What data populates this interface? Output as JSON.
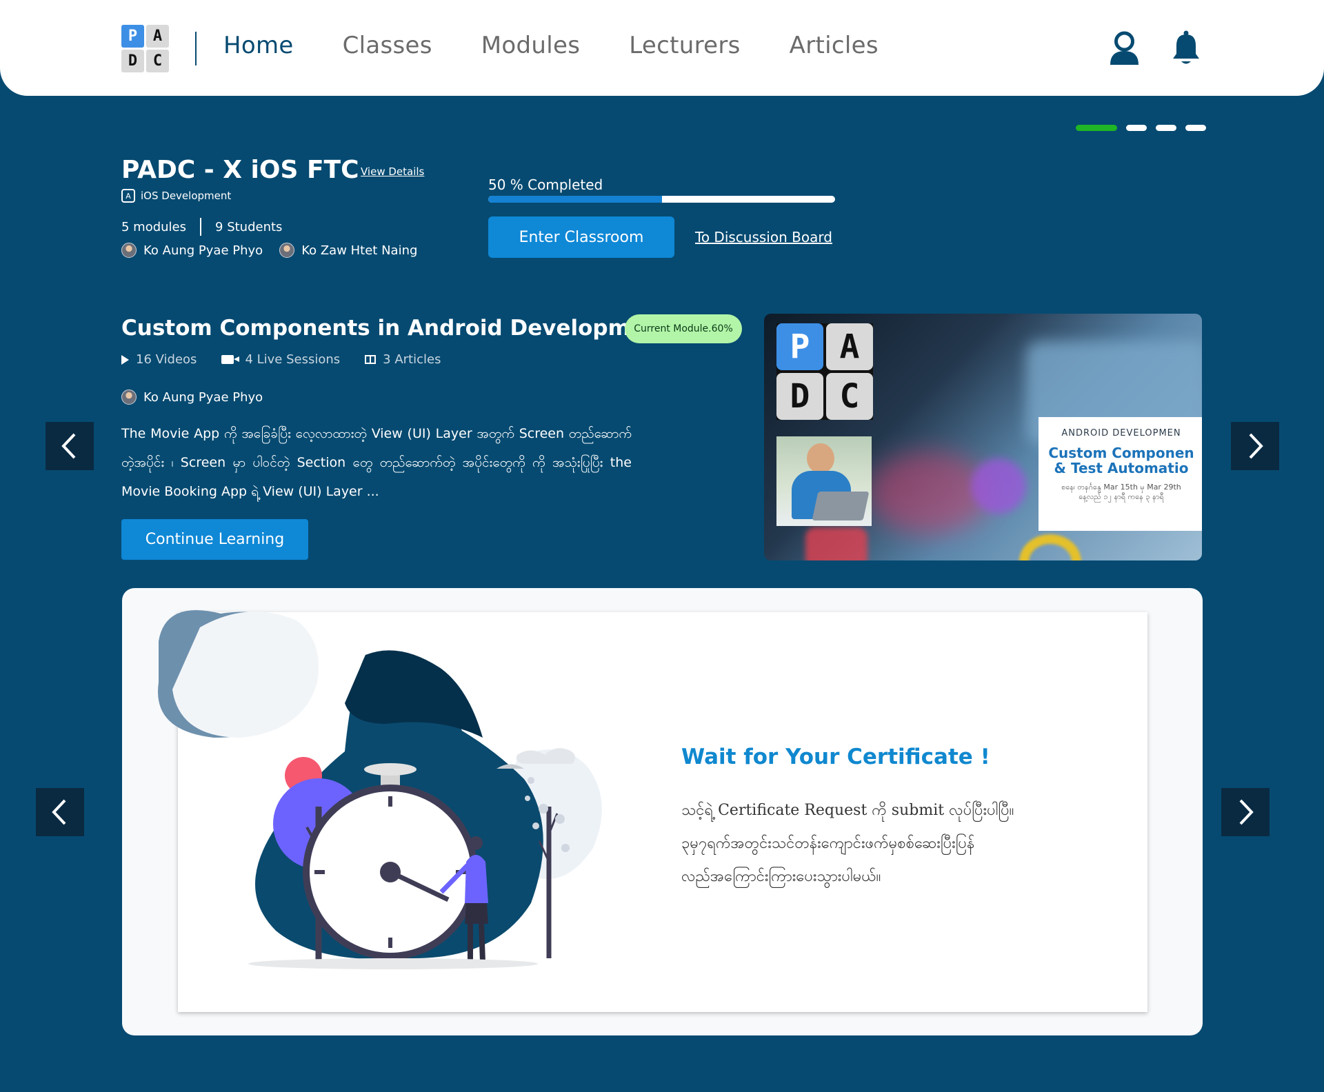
{
  "logo": {
    "letters": [
      "P",
      "A",
      "D",
      "C"
    ]
  },
  "nav": {
    "items": [
      {
        "label": "Home",
        "active": true
      },
      {
        "label": "Classes",
        "active": false
      },
      {
        "label": "Modules",
        "active": false
      },
      {
        "label": "Lecturers",
        "active": false
      },
      {
        "label": "Articles",
        "active": false
      }
    ],
    "icons": [
      "user-icon",
      "bell-icon"
    ]
  },
  "pager": {
    "count": 4,
    "active_index": 0,
    "active_color": "#1fb524"
  },
  "class": {
    "title": "PADC - X iOS FTC",
    "view_details": "View Details",
    "category": "iOS Development",
    "modules": "5 modules",
    "students": "9 Students",
    "lecturers": [
      "Ko Aung Pyae Phyo",
      "Ko Zaw Htet Naing"
    ],
    "progress_label": "50 % Completed",
    "progress": 0.5,
    "enter_label": "Enter Classroom",
    "discussion_label": "To Discussion Board"
  },
  "module": {
    "title": "Custom Components in Android Development",
    "badge": "Current Module.60%",
    "videos": "16 Videos",
    "live_sessions": "4 Live Sessions",
    "articles": "3 Articles",
    "lecturer": "Ko Aung Pyae Phyo",
    "description": "The Movie App ကို အခြေခံပြီး လေ့လာထားတဲ့ View (UI) Layer အတွက် Screen တည်ဆောက်တဲ့အပိုင်း ၊ Screen မှာ ပါဝင်တဲ့ Section တွေ တည်ဆောက်တဲ့ အပိုင်းတွေကို ကို အသုံးပြုပြီး the Movie Booking App ရဲ့ View (UI) Layer ...",
    "continue_label": "Continue Learning",
    "thumbnail": {
      "logo_letters": [
        "P",
        "A",
        "D",
        "C"
      ],
      "card_kicker": "ANDROID DEVELOPMEN",
      "card_title_1": "Custom Componen",
      "card_title_2": "& Test Automatio",
      "card_dates": "စနေ၊ တနင်္ဂနွေ Mar 15th မှ Mar 29th",
      "card_schedule": "နေ့လည် ၁၂ နာရီ ကနေ ၃ နာရီ"
    }
  },
  "certificate": {
    "title": "Wait for Your Certificate !",
    "line1": "သင့်ရဲ့ Certificate Request ကို submit လုပ်ပြီးပါပြီ။",
    "line2": "၃မှ၇ရက်အတွင်းသင်တန်းကျောင်းဖက်မှစစ်ဆေးပြီးပြန်",
    "line3": "လည်အကြောင်းကြားပေးသွားပါမယ်။"
  },
  "colors": {
    "background": "#064a71",
    "primary_button": "#0f88d6",
    "badge": "#b2f5a8",
    "certificate_title": "#1088cf"
  }
}
